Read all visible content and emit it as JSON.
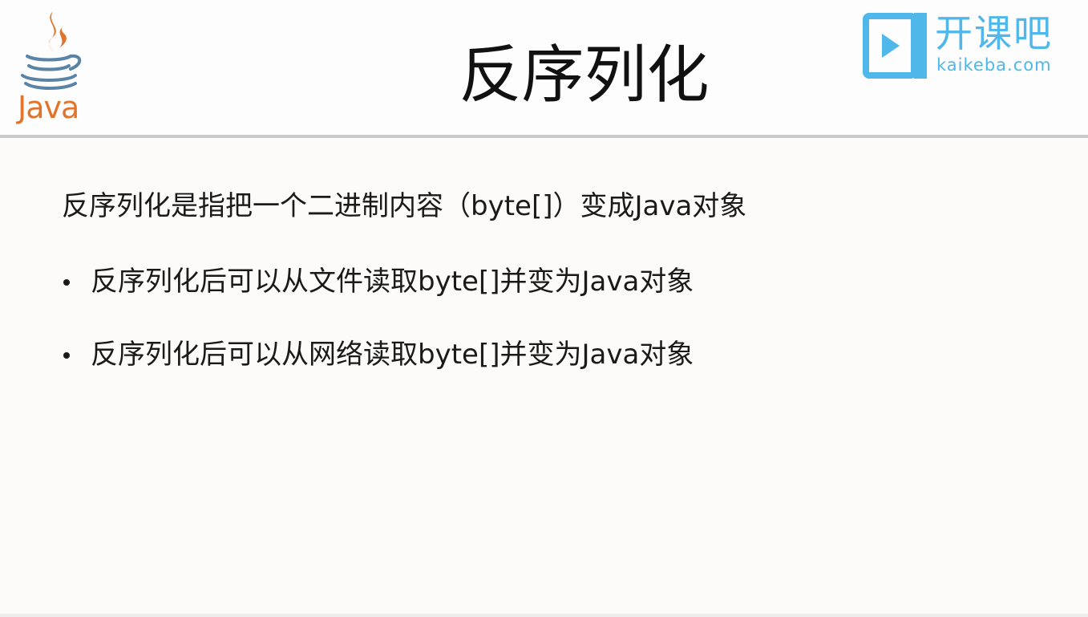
{
  "slide": {
    "title": "反序列化",
    "intro": "反序列化是指把一个二进制内容（byte[]）变成Java对象",
    "bullets": [
      "反序列化后可以从文件读取byte[]并变为Java对象",
      "反序列化后可以从网络读取byte[]并变为Java对象"
    ]
  },
  "logos": {
    "java": {
      "wordmark": "Java",
      "icon": "java-coffee-cup-icon",
      "colors": {
        "steam": "#e0742a",
        "cup": "#5a84a6",
        "text": "#e0742a"
      }
    },
    "kaikeba": {
      "name": "开课吧",
      "domain": "kaikeba.com",
      "icon": "play-screen-icon",
      "color": "#4fb7ea"
    }
  },
  "colors": {
    "background": "#fcfbfa",
    "divider": "#c9c9c9",
    "text": "#1a1a1a"
  }
}
